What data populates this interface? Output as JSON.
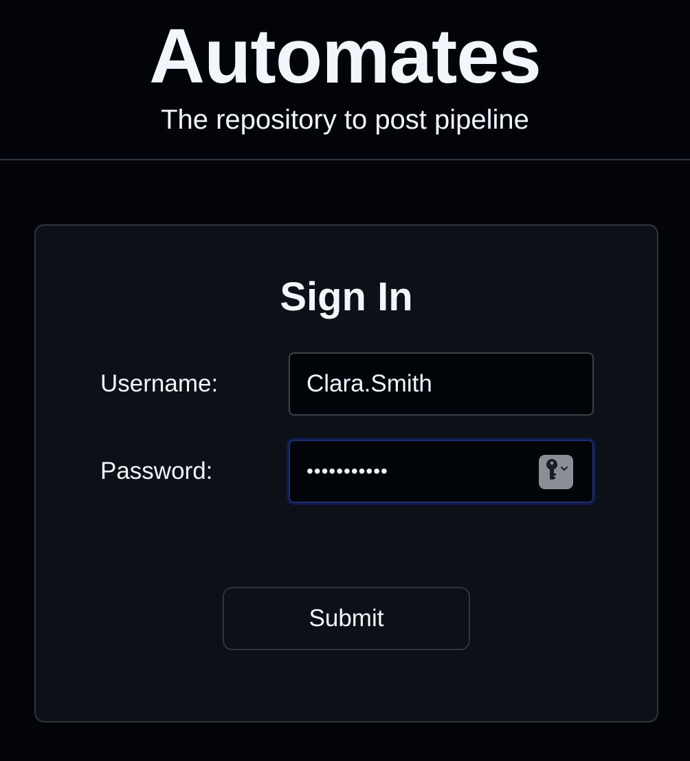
{
  "header": {
    "title": "Automates",
    "subtitle": "The repository to post pipeline"
  },
  "signin": {
    "title": "Sign In",
    "username_label": "Username:",
    "username_value": "Clara.Smith",
    "password_label": "Password:",
    "password_masked": "•••••••••••",
    "submit_label": "Submit"
  },
  "icons": {
    "password_autofill": "key-icon"
  },
  "colors": {
    "background": "#020409",
    "card": "#0d1117",
    "border": "#30363d",
    "text": "#f0f6fc",
    "focus_ring": "#1f2c6e"
  }
}
